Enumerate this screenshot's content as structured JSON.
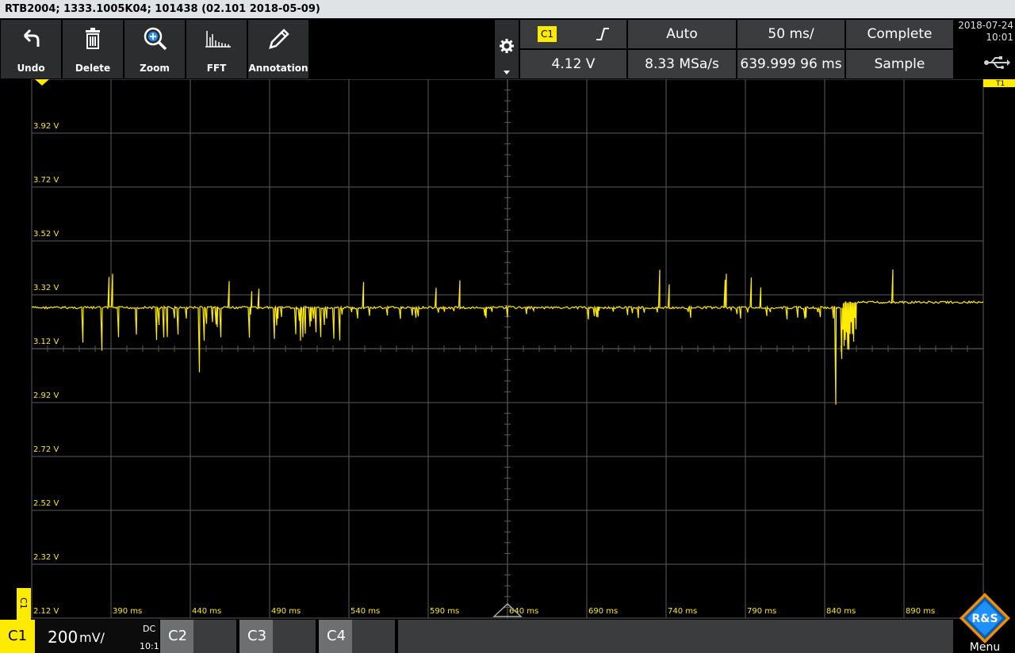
{
  "titlebar": {
    "text": "RTB2004; 1333.1005K04; 101438 (02.101 2018-05-09)"
  },
  "toolbar": {
    "buttons": [
      {
        "id": "undo",
        "label": "Undo",
        "icon": "undo-icon"
      },
      {
        "id": "delete",
        "label": "Delete",
        "icon": "trash-icon"
      },
      {
        "id": "zoom",
        "label": "Zoom",
        "icon": "zoom-icon"
      },
      {
        "id": "fft",
        "label": "FFT",
        "icon": "fft-icon"
      },
      {
        "id": "annotation",
        "label": "Annotation",
        "icon": "pencil-icon"
      }
    ]
  },
  "status": {
    "trigger_channel": "C1",
    "trigger_level": "4.12 V",
    "trigger_mode": "Auto",
    "sample_rate": "8.33 MSa/s",
    "timebase": "50 ms/",
    "record_length": "639.999 96 ms",
    "acq_state": "Complete",
    "acq_mode": "Sample",
    "date": "2018-07-24",
    "time": "10:01"
  },
  "colors": {
    "trace": "#ffeb00",
    "grid": "#5a5a5a",
    "panel": "#3a3c3e"
  },
  "markers": {
    "channel_tag": "C1",
    "trigger_tag": "T1"
  },
  "y_labels": [
    "3.92 V",
    "3.72 V",
    "3.52 V",
    "3.32 V",
    "3.12 V",
    "2.92 V",
    "2.72 V",
    "2.52 V",
    "2.32 V",
    "2.12 V"
  ],
  "x_labels": [
    "390 ms",
    "440 ms",
    "490 ms",
    "540 ms",
    "590 ms",
    "640 ms",
    "690 ms",
    "740 ms",
    "790 ms",
    "840 ms",
    "890 ms"
  ],
  "waveform": {
    "baseline_v": 3.24,
    "end_level_v": 3.26,
    "step_time_ms": 851,
    "dips": [
      {
        "t_ms": 372,
        "v": 3.11
      },
      {
        "t_ms": 384,
        "v": 3.08
      },
      {
        "t_ms": 395,
        "v": 3.13
      },
      {
        "t_ms": 406,
        "v": 3.14
      },
      {
        "t_ms": 419,
        "v": 3.12
      },
      {
        "t_ms": 432,
        "v": 3.14
      },
      {
        "t_ms": 446,
        "v": 3.0
      },
      {
        "t_ms": 459,
        "v": 3.13
      },
      {
        "t_ms": 847,
        "v": 2.88
      }
    ]
  },
  "bottom": {
    "channels": [
      {
        "id": "c1",
        "label": "C1",
        "scale": "200",
        "unit": "mV/",
        "coupling": "DC",
        "probe": "10:1",
        "active": true
      },
      {
        "id": "c2",
        "label": "C2",
        "active": false
      },
      {
        "id": "c3",
        "label": "C3",
        "active": false
      },
      {
        "id": "c4",
        "label": "C4",
        "active": false
      }
    ],
    "menu_label": "Menu",
    "logo_text": "R&S"
  }
}
